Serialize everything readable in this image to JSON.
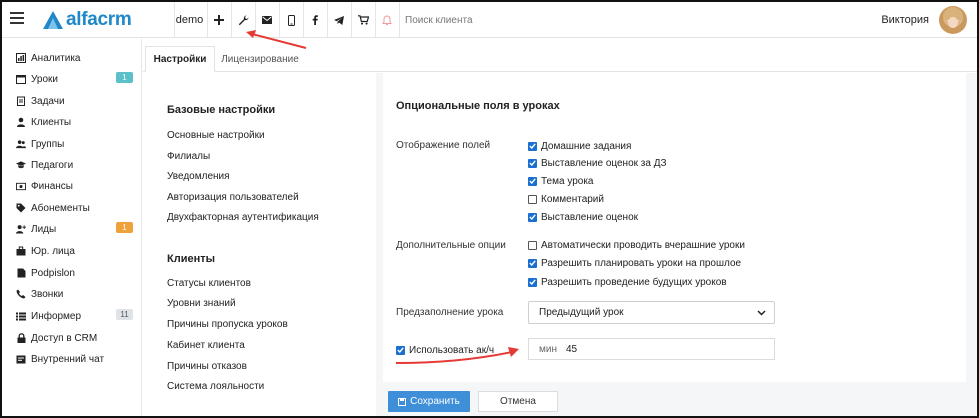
{
  "app": {
    "logo_text": "alfacrm",
    "account": "demo"
  },
  "topbar": {
    "search_placeholder": "Поиск клиента",
    "user_name": "Виктория"
  },
  "sidebar": {
    "items": [
      {
        "label": "Аналитика",
        "icon": "chart-icon"
      },
      {
        "label": "Уроки",
        "icon": "calendar-icon",
        "badge": "1",
        "badge_color": "#5bc0c9"
      },
      {
        "label": "Задачи",
        "icon": "clipboard-icon"
      },
      {
        "label": "Клиенты",
        "icon": "user-icon"
      },
      {
        "label": "Группы",
        "icon": "users-icon"
      },
      {
        "label": "Педагоги",
        "icon": "graduation-cap-icon"
      },
      {
        "label": "Финансы",
        "icon": "money-icon"
      },
      {
        "label": "Абонементы",
        "icon": "tag-icon"
      },
      {
        "label": "Лиды",
        "icon": "user-plus-icon",
        "badge": "1",
        "badge_color": "#f0a23a"
      },
      {
        "label": "Юр. лица",
        "icon": "briefcase-icon"
      },
      {
        "label": "Podpislon",
        "icon": "file-icon"
      },
      {
        "label": "Звонки",
        "icon": "phone-icon"
      },
      {
        "label": "Информер",
        "icon": "list-icon",
        "badge": "11",
        "badge_color": "#dfe3e8"
      },
      {
        "label": "Доступ в CRM",
        "icon": "lock-icon"
      },
      {
        "label": "Внутренний чат",
        "icon": "chat-icon"
      }
    ]
  },
  "tabs": [
    {
      "label": "Настройки"
    },
    {
      "label": "Лицензирование"
    }
  ],
  "settings_menu": {
    "basic_title": "Базовые настройки",
    "basic_items": [
      "Основные настройки",
      "Филиалы",
      "Уведомления",
      "Авторизация пользователей",
      "Двухфакторная аутентификация"
    ],
    "clients_title": "Клиенты",
    "clients_items": [
      "Статусы клиентов",
      "Уровни знаний",
      "Причины пропуска уроков",
      "Кабинет клиента",
      "Причины отказов",
      "Система лояльности"
    ]
  },
  "panel": {
    "title": "Опциональные поля в уроках",
    "display_label": "Отображение полей",
    "display_options": [
      {
        "label": "Домашние задания",
        "checked": true
      },
      {
        "label": "Выставление оценок за ДЗ",
        "checked": true
      },
      {
        "label": "Тема урока",
        "checked": true
      },
      {
        "label": "Комментарий",
        "checked": false
      },
      {
        "label": "Выставление оценок",
        "checked": true
      }
    ],
    "extra_label": "Дополнительные опции",
    "extra_options": [
      {
        "label": "Автоматически проводить вчерашние уроки",
        "checked": false
      },
      {
        "label": "Разрешить планировать уроки на прошлое",
        "checked": true
      },
      {
        "label": "Разрешить проведение будущих уроков",
        "checked": true
      }
    ],
    "prefill_label": "Предзаполнение урока",
    "prefill_value": "Предыдущий урок",
    "academic_hour": {
      "label": "Использовать ак/ч",
      "checked": true,
      "unit": "мин",
      "value": "45"
    }
  },
  "actions": {
    "save_label": "Сохранить",
    "cancel_label": "Отмена"
  },
  "colors": {
    "brand": "#1e88c9",
    "accent": "#3f8fd8",
    "checkbox": "#1a6fd0",
    "annotation": "#e53935"
  }
}
